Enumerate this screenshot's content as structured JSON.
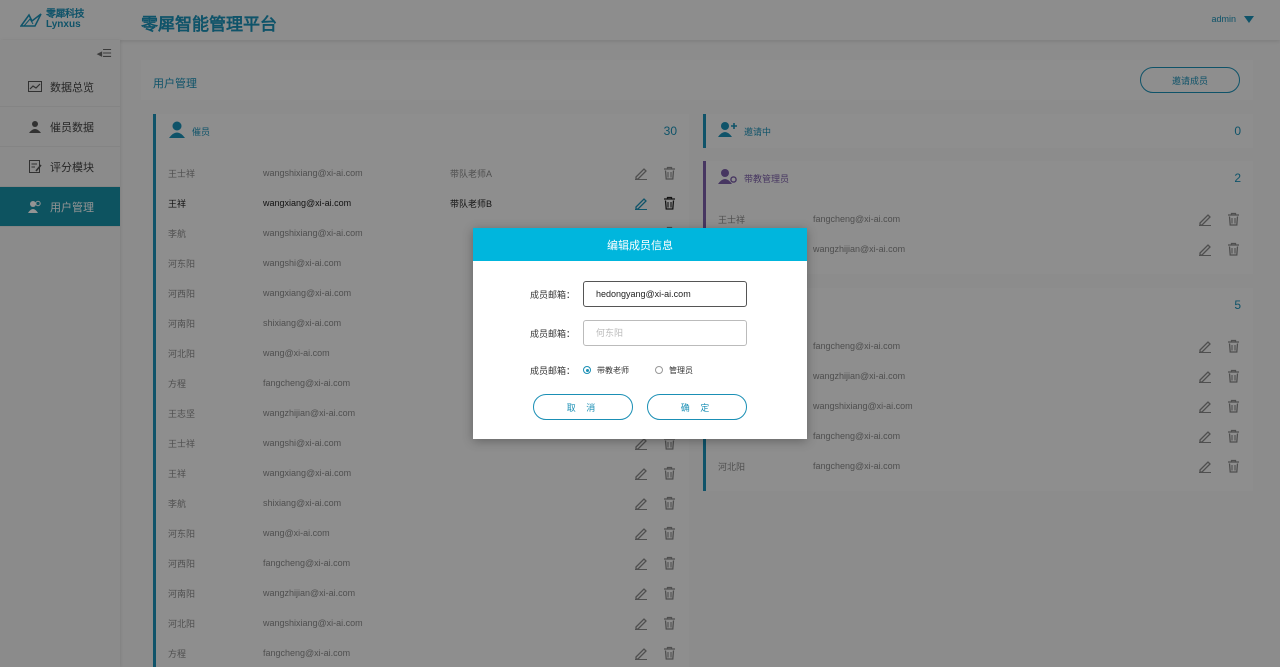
{
  "brand": {
    "logo_cn": "零犀科技",
    "logo_en": "Lynxus",
    "app_title": "零犀智能管理平台",
    "user": "admin",
    "accent": "#1a8fb5",
    "dialog_header_color": "#00b6dd"
  },
  "sidebar": {
    "collapse_icon": "collapse-icon",
    "items": [
      {
        "label": "数据总览",
        "icon": "chart-icon",
        "active": false
      },
      {
        "label": "催员数据",
        "icon": "user-icon",
        "active": false
      },
      {
        "label": "评分模块",
        "icon": "edit-icon",
        "active": false
      },
      {
        "label": "用户管理",
        "icon": "users-icon",
        "active": true
      }
    ]
  },
  "page": {
    "title": "用户管理",
    "invite_label": "邀请成员"
  },
  "left_card": {
    "title": "催员",
    "count": "30",
    "rows": [
      {
        "name": "王士祥",
        "email": "wangshixiang@xi-ai.com",
        "note": "带队老师A"
      },
      {
        "name": "王祥",
        "email": "wangxiang@xi-ai.com",
        "note": "带队老师B"
      },
      {
        "name": "李航",
        "email": "wangshixiang@xi-ai.com",
        "note": ""
      },
      {
        "name": "河东阳",
        "email": "wangshi@xi-ai.com",
        "note": ""
      },
      {
        "name": "河西阳",
        "email": "wangxiang@xi-ai.com",
        "note": ""
      },
      {
        "name": "河南阳",
        "email": "shixiang@xi-ai.com",
        "note": ""
      },
      {
        "name": "河北阳",
        "email": "wang@xi-ai.com",
        "note": ""
      },
      {
        "name": "方程",
        "email": "fangcheng@xi-ai.com",
        "note": ""
      },
      {
        "name": "王志坚",
        "email": "wangzhijian@xi-ai.com",
        "note": ""
      },
      {
        "name": "王士祥",
        "email": "wangshi@xi-ai.com",
        "note": ""
      },
      {
        "name": "王祥",
        "email": "wangxiang@xi-ai.com",
        "note": ""
      },
      {
        "name": "李航",
        "email": "shixiang@xi-ai.com",
        "note": ""
      },
      {
        "name": "河东阳",
        "email": "wang@xi-ai.com",
        "note": ""
      },
      {
        "name": "河西阳",
        "email": "fangcheng@xi-ai.com",
        "note": ""
      },
      {
        "name": "河南阳",
        "email": "wangzhijian@xi-ai.com",
        "note": ""
      },
      {
        "name": "河北阳",
        "email": "wangshixiang@xi-ai.com",
        "note": ""
      },
      {
        "name": "方程",
        "email": "fangcheng@xi-ai.com",
        "note": ""
      }
    ]
  },
  "inviting_card": {
    "title": "邀请中",
    "count": "0"
  },
  "teacher_card": {
    "title": "带教管理员",
    "count": "2",
    "rows": [
      {
        "name": "王士祥",
        "email": "fangcheng@xi-ai.com"
      },
      {
        "name": "",
        "email": "wangzhijian@xi-ai.com"
      }
    ]
  },
  "admin_card": {
    "count": "5",
    "rows": [
      {
        "name": "",
        "email": "fangcheng@xi-ai.com"
      },
      {
        "name": "",
        "email": "wangzhijian@xi-ai.com"
      },
      {
        "name": "",
        "email": "wangshixiang@xi-ai.com"
      },
      {
        "name": "",
        "email": "fangcheng@xi-ai.com"
      },
      {
        "name": "河北阳",
        "email": "fangcheng@xi-ai.com"
      }
    ]
  },
  "dialog": {
    "title": "编辑成员信息",
    "email_label": "成员邮箱：",
    "email_value": "hedongyang@xi-ai.com",
    "name_label": "成员邮箱：",
    "name_placeholder": "何东阳",
    "role_label": "成员邮箱：",
    "roles": [
      {
        "label": "带教老师",
        "selected": true
      },
      {
        "label": "管理员",
        "selected": false
      }
    ],
    "cancel_label": "取 消",
    "confirm_label": "确 定"
  }
}
